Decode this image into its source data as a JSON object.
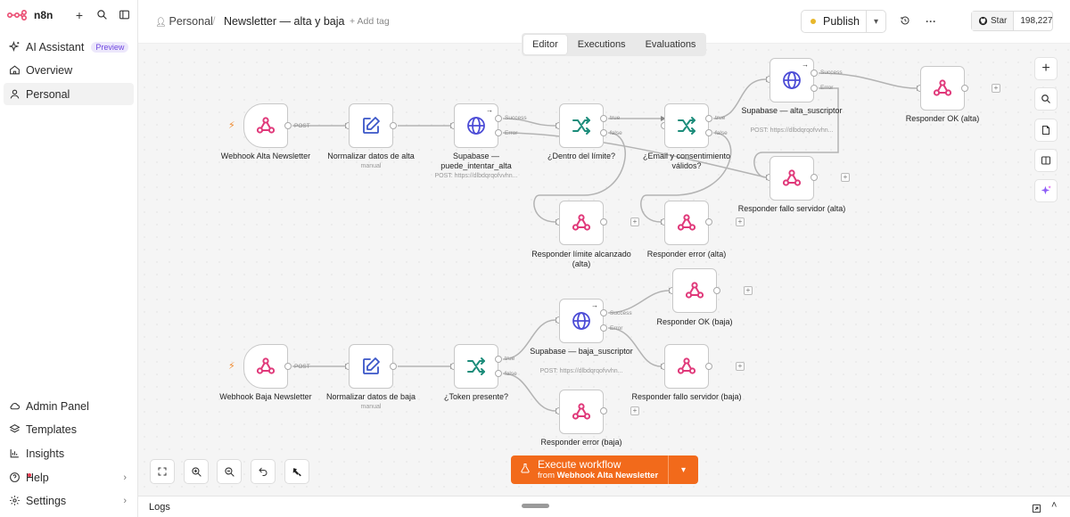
{
  "brand": {
    "name": "n8n"
  },
  "sidebar": {
    "items": [
      {
        "label": "AI Assistant",
        "badge": "Preview"
      },
      {
        "label": "Overview"
      },
      {
        "label": "Personal"
      }
    ],
    "bottom": [
      {
        "label": "Admin Panel"
      },
      {
        "label": "Templates"
      },
      {
        "label": "Insights"
      },
      {
        "label": "Help"
      },
      {
        "label": "Settings"
      }
    ]
  },
  "header": {
    "project": "Personal",
    "title": "Newsletter — alta y baja",
    "add_tag": "+ Add tag",
    "publish": "Publish",
    "github_star": "Star",
    "github_count": "198,227"
  },
  "tabs": [
    {
      "label": "Editor",
      "active": true
    },
    {
      "label": "Executions"
    },
    {
      "label": "Evaluations"
    }
  ],
  "nodes": {
    "webhook_alta": {
      "label": "Webhook Alta Newsletter",
      "port": "POST"
    },
    "norm_alta": {
      "label": "Normalizar datos de alta",
      "sub": "manual"
    },
    "supa_puede": {
      "label": "Supabase — puede_intentar_alta",
      "sub": "POST: https://dlbdqrqofvvhn...",
      "out1": "Success",
      "out2": "Error"
    },
    "dentro_limite": {
      "label": "¿Dentro del límite?",
      "out1": "true",
      "out2": "false"
    },
    "email_consent": {
      "label": "¿Email y consentimiento válidos?",
      "out1": "true",
      "out2": "false"
    },
    "supa_alta": {
      "label": "Supabase — alta_suscriptor",
      "sub": "POST: https://dlbdqrqofvvhn...",
      "out1": "Success",
      "out2": "Error"
    },
    "resp_ok_alta": {
      "label": "Responder OK (alta)"
    },
    "resp_fallo_alta": {
      "label": "Responder fallo servidor (alta)"
    },
    "resp_limite": {
      "label": "Responder límite alcanzado (alta)"
    },
    "resp_error_alta": {
      "label": "Responder error (alta)"
    },
    "webhook_baja": {
      "label": "Webhook Baja Newsletter",
      "port": "POST"
    },
    "norm_baja": {
      "label": "Normalizar datos de baja",
      "sub": "manual"
    },
    "token": {
      "label": "¿Token presente?",
      "out1": "true",
      "out2": "false"
    },
    "supa_baja": {
      "label": "Supabase — baja_suscriptor",
      "sub": "POST: https://dlbdqrqofvvhn...",
      "out1": "Success",
      "out2": "Error"
    },
    "resp_ok_baja": {
      "label": "Responder OK (baja)"
    },
    "resp_fallo_baja": {
      "label": "Responder fallo servidor (baja)"
    },
    "resp_error_baja": {
      "label": "Responder error (baja)"
    }
  },
  "execute": {
    "title": "Execute workflow",
    "prefix": "from",
    "target": "Webhook Alta Newsletter"
  },
  "logs": {
    "label": "Logs"
  },
  "colors": {
    "accent": "#f26a1b",
    "webhook": "#e0397a",
    "switch": "#1b8c7a",
    "http": "#4c4cd6",
    "edit": "#3a56c8"
  }
}
